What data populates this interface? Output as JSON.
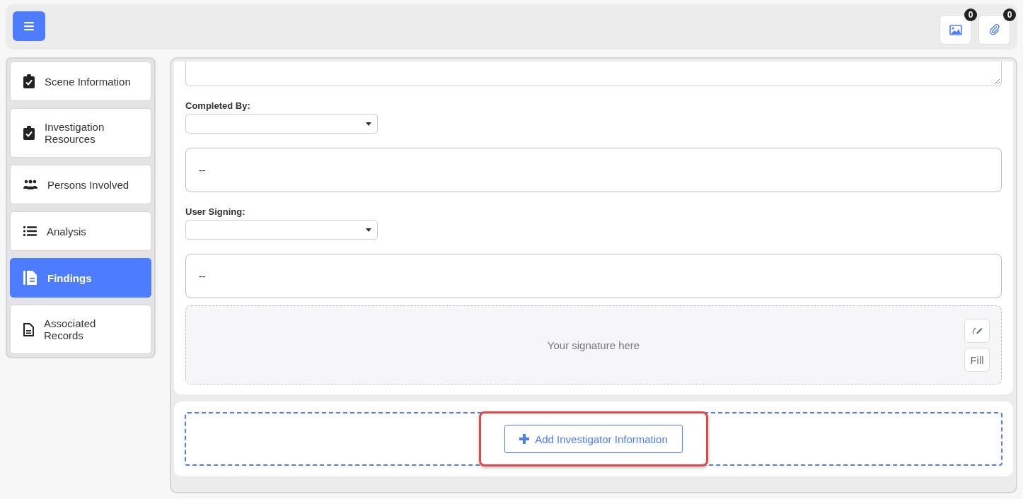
{
  "top_bar": {
    "badges": [
      {
        "kind": "image",
        "count": "0"
      },
      {
        "kind": "paperclip",
        "count": "0"
      }
    ]
  },
  "sidebar": {
    "items": [
      {
        "label": "Scene Information",
        "kind": "clipboard-check",
        "selected": false
      },
      {
        "label": "Investigation Resources",
        "kind": "clipboard-check",
        "selected": false
      },
      {
        "label": "Persons Involved",
        "kind": "people",
        "selected": false
      },
      {
        "label": "Analysis",
        "kind": "list",
        "selected": false
      },
      {
        "label": "Findings",
        "kind": "file",
        "selected": true
      },
      {
        "label": "Associated Records",
        "kind": "file-lines",
        "selected": false
      }
    ]
  },
  "form": {
    "fields": [
      {
        "kind": "textarea"
      },
      {
        "kind": "select",
        "label": "Completed By:"
      },
      {
        "kind": "display",
        "value": "--"
      },
      {
        "kind": "select",
        "label": "User Signing:"
      },
      {
        "kind": "display",
        "value": "--"
      },
      {
        "kind": "signature",
        "placeholder": "Your signature here",
        "fill_button": "Fill"
      }
    ]
  },
  "add_button": {
    "label": "Add Investigator Information",
    "highlighted": true
  }
}
